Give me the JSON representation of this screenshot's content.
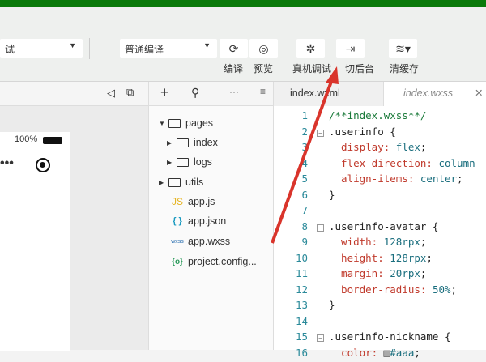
{
  "toolbar": {
    "mode_select": "试",
    "compile_select": "普通编译",
    "buttons": [
      {
        "label": "编译",
        "icon": "refresh-icon"
      },
      {
        "label": "预览",
        "icon": "eye-icon"
      },
      {
        "label": "真机调试",
        "icon": "bug-icon"
      },
      {
        "label": "切后台",
        "icon": "switch-background-icon"
      },
      {
        "label": "清缓存",
        "icon": "layers-icon"
      }
    ]
  },
  "simulator": {
    "battery": "100%"
  },
  "tree": {
    "items": [
      {
        "label": "pages",
        "icon": "folder-open-icon"
      },
      {
        "label": "index",
        "icon": "folder-icon"
      },
      {
        "label": "logs",
        "icon": "folder-icon"
      },
      {
        "label": "utils",
        "icon": "folder-icon"
      },
      {
        "label": "app.js",
        "badge": "JS"
      },
      {
        "label": "app.json",
        "badge": "{ }"
      },
      {
        "label": "app.wxss",
        "badge": "wxss"
      },
      {
        "label": "project.config...",
        "badge": "{o}"
      }
    ]
  },
  "editor": {
    "tabs": [
      "index.wxml",
      "index.wxss"
    ],
    "lines": [
      {
        "n": "1",
        "parts": [
          [
            "cm",
            "/**index.wxss**/"
          ]
        ]
      },
      {
        "n": "2",
        "fold": true,
        "parts": [
          [
            "sel",
            ".userinfo {"
          ]
        ]
      },
      {
        "n": "3",
        "parts": [
          [
            "prop",
            "  display: "
          ],
          [
            "val",
            "flex"
          ],
          [
            "sel",
            ";"
          ]
        ]
      },
      {
        "n": "4",
        "parts": [
          [
            "prop",
            "  flex-direction: "
          ],
          [
            "val",
            "column"
          ]
        ]
      },
      {
        "n": "5",
        "parts": [
          [
            "prop",
            "  align-items: "
          ],
          [
            "val",
            "center"
          ],
          [
            "sel",
            ";"
          ]
        ]
      },
      {
        "n": "6",
        "parts": [
          [
            "sel",
            "}"
          ]
        ]
      },
      {
        "n": "7",
        "parts": []
      },
      {
        "n": "8",
        "fold": true,
        "parts": [
          [
            "sel",
            ".userinfo-avatar {"
          ]
        ]
      },
      {
        "n": "9",
        "parts": [
          [
            "prop",
            "  width: "
          ],
          [
            "val",
            "128rpx"
          ],
          [
            "sel",
            ";"
          ]
        ]
      },
      {
        "n": "10",
        "parts": [
          [
            "prop",
            "  height: "
          ],
          [
            "val",
            "128rpx"
          ],
          [
            "sel",
            ";"
          ]
        ]
      },
      {
        "n": "11",
        "parts": [
          [
            "prop",
            "  margin: "
          ],
          [
            "val",
            "20rpx"
          ],
          [
            "sel",
            ";"
          ]
        ]
      },
      {
        "n": "12",
        "parts": [
          [
            "prop",
            "  border-radius: "
          ],
          [
            "val",
            "50%"
          ],
          [
            "sel",
            ";"
          ]
        ]
      },
      {
        "n": "13",
        "parts": [
          [
            "sel",
            "}"
          ]
        ]
      },
      {
        "n": "14",
        "parts": []
      },
      {
        "n": "15",
        "fold": true,
        "parts": [
          [
            "sel",
            ".userinfo-nickname {"
          ]
        ]
      },
      {
        "n": "16",
        "parts": [
          [
            "prop",
            "  color: "
          ],
          [
            "swatch",
            "■"
          ],
          [
            "val",
            "#aaa"
          ],
          [
            "sel",
            ";"
          ]
        ]
      }
    ]
  },
  "colors": {
    "brand": "#0a7a0a",
    "arrow": "#d9342b"
  }
}
